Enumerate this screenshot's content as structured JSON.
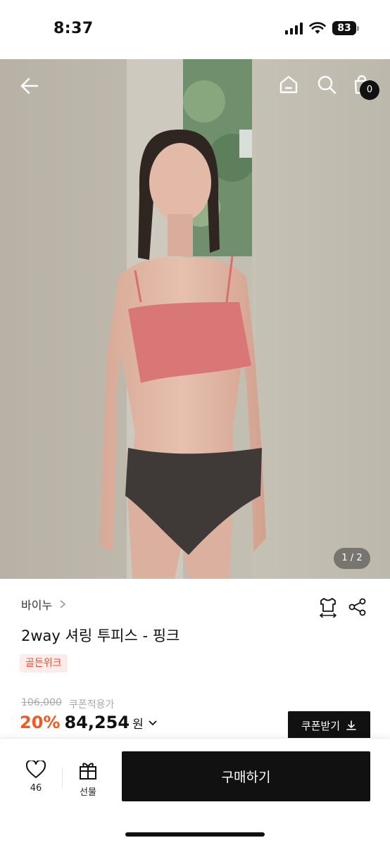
{
  "status_bar": {
    "time": "8:37",
    "battery": "83"
  },
  "nav": {
    "back_icon": "arrow-left-icon",
    "home_icon": "home-icon",
    "search_icon": "search-icon",
    "cart_icon": "shopping-bag-icon",
    "cart_count": "0"
  },
  "gallery": {
    "counter": "1 / 2"
  },
  "product": {
    "brand": "바이누",
    "title": "2way 셔링 투피스 - 핑크",
    "badge": "골든위크",
    "original_price": "106,000",
    "coupon_note": "쿠폰적용가",
    "discount": "20%",
    "price": "84,254",
    "currency": "원",
    "coupon_button": "쿠폰받기"
  },
  "bottom_bar": {
    "like_count": "46",
    "gift_label": "선물",
    "buy_label": "구매하기"
  },
  "colors": {
    "discount": "#ef5a22",
    "badge_text": "#e4522f",
    "badge_bg": "#fdecea",
    "primary_button": "#111111"
  }
}
